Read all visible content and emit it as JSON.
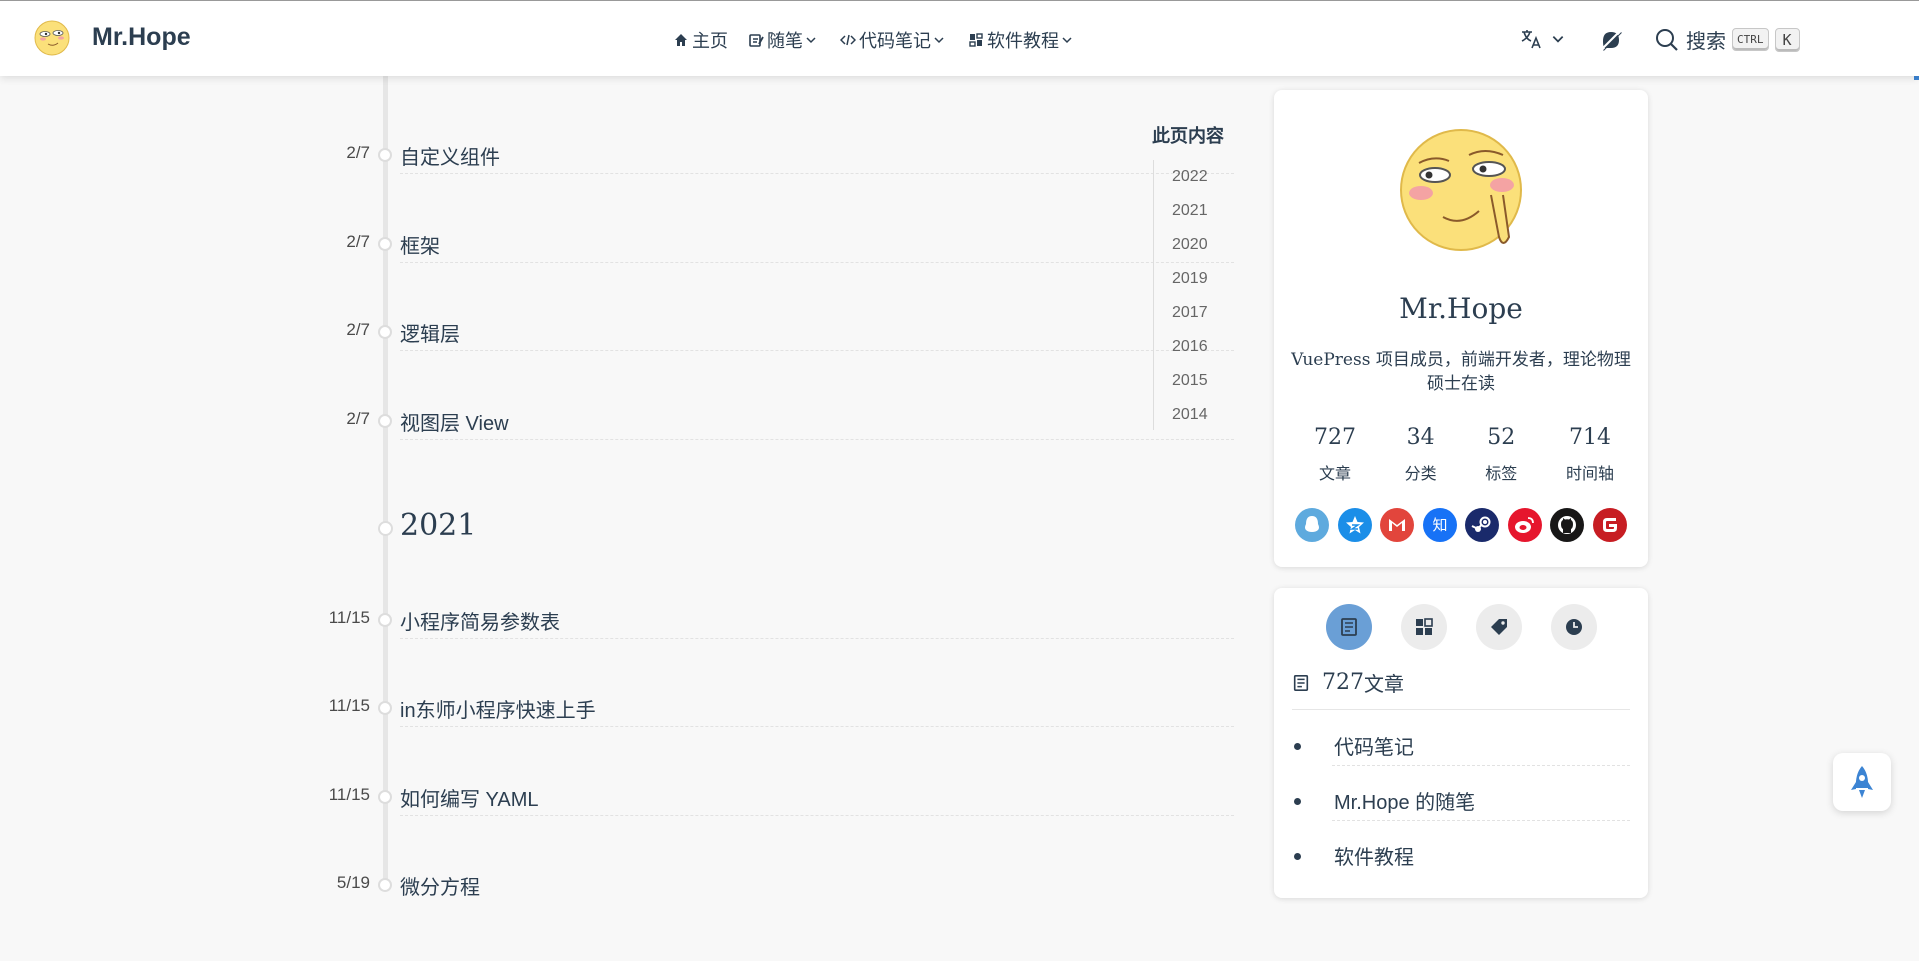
{
  "navbar": {
    "brand": "Mr.Hope",
    "links": [
      {
        "label": "主页",
        "icon": "home-icon",
        "dropdown": false
      },
      {
        "label": "随笔",
        "icon": "note-icon",
        "dropdown": true
      },
      {
        "label": "代码笔记",
        "icon": "code-icon",
        "dropdown": true
      },
      {
        "label": "软件教程",
        "icon": "software-icon",
        "dropdown": true
      }
    ],
    "search_label": "搜索",
    "kbd_ctrl": "CTRL",
    "kbd_k": "K"
  },
  "timeline": {
    "items_2022": [
      {
        "date": "2/7",
        "title": "自定义组件"
      },
      {
        "date": "2/7",
        "title": "框架"
      },
      {
        "date": "2/7",
        "title": "逻辑层"
      },
      {
        "date": "2/7",
        "title": "视图层 View"
      }
    ],
    "year_2021": "2021",
    "items_2021": [
      {
        "date": "11/15",
        "title": "小程序简易参数表"
      },
      {
        "date": "11/15",
        "title": "in东师小程序快速上手"
      },
      {
        "date": "11/15",
        "title": "如何编写 YAML"
      },
      {
        "date": "5/19",
        "title": "微分方程"
      }
    ]
  },
  "toc": {
    "title": "此页内容",
    "years": [
      "2022",
      "2021",
      "2020",
      "2019",
      "2017",
      "2016",
      "2015",
      "2014"
    ]
  },
  "profile": {
    "name": "Mr.Hope",
    "description": "VuePress 项目成员，前端开发者，理论物理硕士在读",
    "stats": [
      {
        "num": "727",
        "label": "文章"
      },
      {
        "num": "34",
        "label": "分类"
      },
      {
        "num": "52",
        "label": "标签"
      },
      {
        "num": "714",
        "label": "时间轴"
      }
    ],
    "socials": [
      {
        "name": "qq-icon",
        "color": "#5eaade"
      },
      {
        "name": "qzone-icon",
        "color": "#1b8ee8"
      },
      {
        "name": "gmail-icon",
        "color": "#e2453c"
      },
      {
        "name": "zhihu-icon",
        "color": "#1772f6"
      },
      {
        "name": "steam-icon",
        "color": "#1a2a6b"
      },
      {
        "name": "weibo-icon",
        "color": "#e6162d"
      },
      {
        "name": "github-icon",
        "color": "#181717"
      },
      {
        "name": "gitee-icon",
        "color": "#c71d23"
      }
    ]
  },
  "category_card": {
    "count": "727",
    "label": "文章",
    "items": [
      "代码笔记",
      "Mr.Hope 的随笔",
      "软件教程"
    ]
  }
}
